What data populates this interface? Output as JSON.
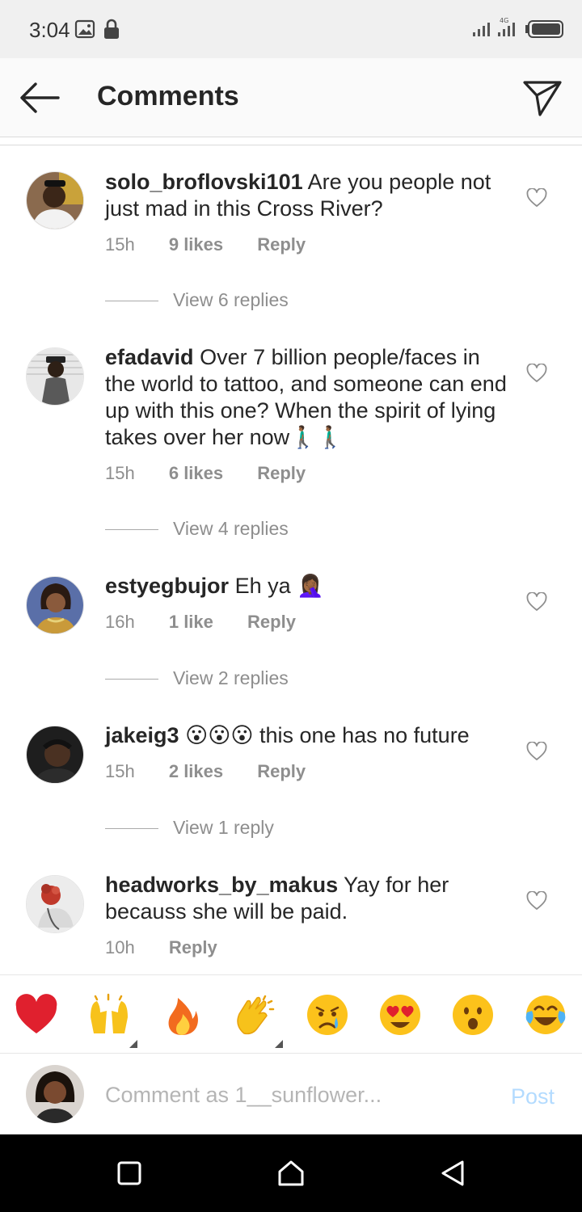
{
  "status_bar": {
    "time": "3:04"
  },
  "header": {
    "title": "Comments"
  },
  "comments": [
    {
      "username": "solo_broflovski101",
      "text": "Are you people not just mad in this Cross River?",
      "time": "15h",
      "likes": "9 likes",
      "reply": "Reply",
      "view_replies": "View 6 replies"
    },
    {
      "username": "efadavid",
      "text": "Over 7 billion people/faces in the world to tattoo, and someone can end up with this one?  When the spirit of lying takes over her now🚶🏾‍♂️🚶🏾‍♂️",
      "time": "15h",
      "likes": "6 likes",
      "reply": "Reply",
      "view_replies": "View 4 replies"
    },
    {
      "username": "estyegbujor",
      "text": "Eh ya 🤦🏾‍♀️",
      "time": "16h",
      "likes": "1 like",
      "reply": "Reply",
      "view_replies": "View 2 replies"
    },
    {
      "username": "jakeig3",
      "text": "😮😮😮 this one has no future",
      "time": "15h",
      "likes": "2 likes",
      "reply": "Reply",
      "view_replies": "View 1 reply"
    },
    {
      "username": "headworks_by_makus",
      "text": "Yay for her becauss she will be paid.",
      "time": "10h",
      "reply": "Reply"
    }
  ],
  "reactions": [
    "red-heart",
    "raising-hands",
    "fire",
    "clapping-hands",
    "crying-face",
    "heart-eyes-face",
    "astonished-face",
    "tears-of-joy-face"
  ],
  "comment_input": {
    "placeholder": "Comment as 1__sunflower...",
    "post_label": "Post"
  },
  "colors": {
    "accent_disabled": "#b3dbff",
    "muted_text": "#8e8e8e",
    "like_red": "#ed4956"
  }
}
